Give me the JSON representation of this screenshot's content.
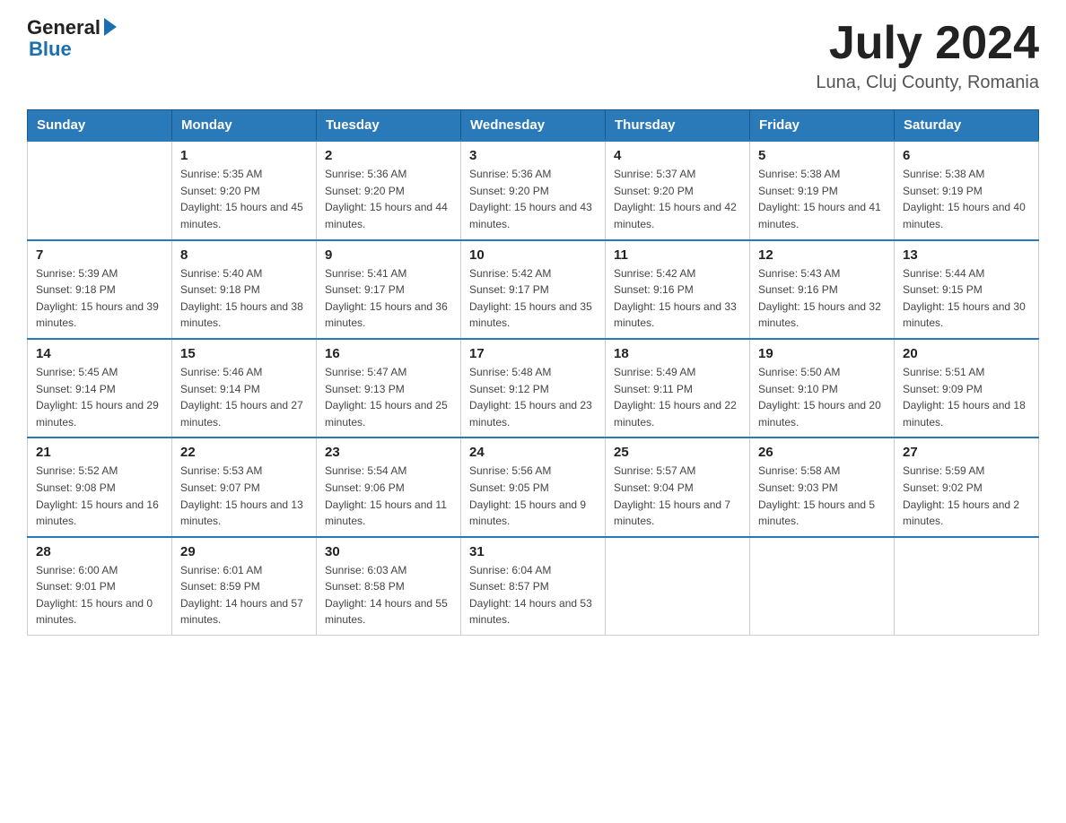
{
  "header": {
    "logo_line1": "General",
    "logo_line2": "Blue",
    "month_year": "July 2024",
    "location": "Luna, Cluj County, Romania"
  },
  "days_of_week": [
    "Sunday",
    "Monday",
    "Tuesday",
    "Wednesday",
    "Thursday",
    "Friday",
    "Saturday"
  ],
  "weeks": [
    [
      {
        "num": "",
        "sunrise": "",
        "sunset": "",
        "daylight": ""
      },
      {
        "num": "1",
        "sunrise": "Sunrise: 5:35 AM",
        "sunset": "Sunset: 9:20 PM",
        "daylight": "Daylight: 15 hours and 45 minutes."
      },
      {
        "num": "2",
        "sunrise": "Sunrise: 5:36 AM",
        "sunset": "Sunset: 9:20 PM",
        "daylight": "Daylight: 15 hours and 44 minutes."
      },
      {
        "num": "3",
        "sunrise": "Sunrise: 5:36 AM",
        "sunset": "Sunset: 9:20 PM",
        "daylight": "Daylight: 15 hours and 43 minutes."
      },
      {
        "num": "4",
        "sunrise": "Sunrise: 5:37 AM",
        "sunset": "Sunset: 9:20 PM",
        "daylight": "Daylight: 15 hours and 42 minutes."
      },
      {
        "num": "5",
        "sunrise": "Sunrise: 5:38 AM",
        "sunset": "Sunset: 9:19 PM",
        "daylight": "Daylight: 15 hours and 41 minutes."
      },
      {
        "num": "6",
        "sunrise": "Sunrise: 5:38 AM",
        "sunset": "Sunset: 9:19 PM",
        "daylight": "Daylight: 15 hours and 40 minutes."
      }
    ],
    [
      {
        "num": "7",
        "sunrise": "Sunrise: 5:39 AM",
        "sunset": "Sunset: 9:18 PM",
        "daylight": "Daylight: 15 hours and 39 minutes."
      },
      {
        "num": "8",
        "sunrise": "Sunrise: 5:40 AM",
        "sunset": "Sunset: 9:18 PM",
        "daylight": "Daylight: 15 hours and 38 minutes."
      },
      {
        "num": "9",
        "sunrise": "Sunrise: 5:41 AM",
        "sunset": "Sunset: 9:17 PM",
        "daylight": "Daylight: 15 hours and 36 minutes."
      },
      {
        "num": "10",
        "sunrise": "Sunrise: 5:42 AM",
        "sunset": "Sunset: 9:17 PM",
        "daylight": "Daylight: 15 hours and 35 minutes."
      },
      {
        "num": "11",
        "sunrise": "Sunrise: 5:42 AM",
        "sunset": "Sunset: 9:16 PM",
        "daylight": "Daylight: 15 hours and 33 minutes."
      },
      {
        "num": "12",
        "sunrise": "Sunrise: 5:43 AM",
        "sunset": "Sunset: 9:16 PM",
        "daylight": "Daylight: 15 hours and 32 minutes."
      },
      {
        "num": "13",
        "sunrise": "Sunrise: 5:44 AM",
        "sunset": "Sunset: 9:15 PM",
        "daylight": "Daylight: 15 hours and 30 minutes."
      }
    ],
    [
      {
        "num": "14",
        "sunrise": "Sunrise: 5:45 AM",
        "sunset": "Sunset: 9:14 PM",
        "daylight": "Daylight: 15 hours and 29 minutes."
      },
      {
        "num": "15",
        "sunrise": "Sunrise: 5:46 AM",
        "sunset": "Sunset: 9:14 PM",
        "daylight": "Daylight: 15 hours and 27 minutes."
      },
      {
        "num": "16",
        "sunrise": "Sunrise: 5:47 AM",
        "sunset": "Sunset: 9:13 PM",
        "daylight": "Daylight: 15 hours and 25 minutes."
      },
      {
        "num": "17",
        "sunrise": "Sunrise: 5:48 AM",
        "sunset": "Sunset: 9:12 PM",
        "daylight": "Daylight: 15 hours and 23 minutes."
      },
      {
        "num": "18",
        "sunrise": "Sunrise: 5:49 AM",
        "sunset": "Sunset: 9:11 PM",
        "daylight": "Daylight: 15 hours and 22 minutes."
      },
      {
        "num": "19",
        "sunrise": "Sunrise: 5:50 AM",
        "sunset": "Sunset: 9:10 PM",
        "daylight": "Daylight: 15 hours and 20 minutes."
      },
      {
        "num": "20",
        "sunrise": "Sunrise: 5:51 AM",
        "sunset": "Sunset: 9:09 PM",
        "daylight": "Daylight: 15 hours and 18 minutes."
      }
    ],
    [
      {
        "num": "21",
        "sunrise": "Sunrise: 5:52 AM",
        "sunset": "Sunset: 9:08 PM",
        "daylight": "Daylight: 15 hours and 16 minutes."
      },
      {
        "num": "22",
        "sunrise": "Sunrise: 5:53 AM",
        "sunset": "Sunset: 9:07 PM",
        "daylight": "Daylight: 15 hours and 13 minutes."
      },
      {
        "num": "23",
        "sunrise": "Sunrise: 5:54 AM",
        "sunset": "Sunset: 9:06 PM",
        "daylight": "Daylight: 15 hours and 11 minutes."
      },
      {
        "num": "24",
        "sunrise": "Sunrise: 5:56 AM",
        "sunset": "Sunset: 9:05 PM",
        "daylight": "Daylight: 15 hours and 9 minutes."
      },
      {
        "num": "25",
        "sunrise": "Sunrise: 5:57 AM",
        "sunset": "Sunset: 9:04 PM",
        "daylight": "Daylight: 15 hours and 7 minutes."
      },
      {
        "num": "26",
        "sunrise": "Sunrise: 5:58 AM",
        "sunset": "Sunset: 9:03 PM",
        "daylight": "Daylight: 15 hours and 5 minutes."
      },
      {
        "num": "27",
        "sunrise": "Sunrise: 5:59 AM",
        "sunset": "Sunset: 9:02 PM",
        "daylight": "Daylight: 15 hours and 2 minutes."
      }
    ],
    [
      {
        "num": "28",
        "sunrise": "Sunrise: 6:00 AM",
        "sunset": "Sunset: 9:01 PM",
        "daylight": "Daylight: 15 hours and 0 minutes."
      },
      {
        "num": "29",
        "sunrise": "Sunrise: 6:01 AM",
        "sunset": "Sunset: 8:59 PM",
        "daylight": "Daylight: 14 hours and 57 minutes."
      },
      {
        "num": "30",
        "sunrise": "Sunrise: 6:03 AM",
        "sunset": "Sunset: 8:58 PM",
        "daylight": "Daylight: 14 hours and 55 minutes."
      },
      {
        "num": "31",
        "sunrise": "Sunrise: 6:04 AM",
        "sunset": "Sunset: 8:57 PM",
        "daylight": "Daylight: 14 hours and 53 minutes."
      },
      {
        "num": "",
        "sunrise": "",
        "sunset": "",
        "daylight": ""
      },
      {
        "num": "",
        "sunrise": "",
        "sunset": "",
        "daylight": ""
      },
      {
        "num": "",
        "sunrise": "",
        "sunset": "",
        "daylight": ""
      }
    ]
  ]
}
